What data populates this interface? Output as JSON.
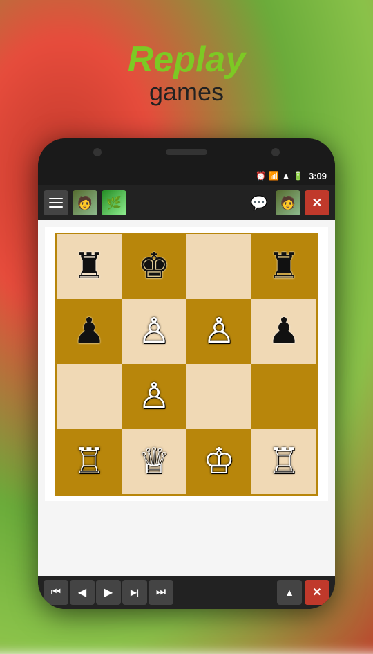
{
  "title": {
    "replay": "Replay",
    "games": "games"
  },
  "status_bar": {
    "time": "3:09",
    "icons": [
      "alarm",
      "wifi",
      "signal",
      "battery"
    ]
  },
  "toolbar": {
    "menu_label": "menu",
    "chat_icon": "💬",
    "avatar_icon": "👤",
    "close_label": "✕"
  },
  "chess_board": {
    "cells": [
      {
        "row": 0,
        "col": 0,
        "color": "light",
        "piece": "♜",
        "piece_name": "black-rook"
      },
      {
        "row": 0,
        "col": 1,
        "color": "dark",
        "piece": "♚",
        "piece_name": "black-king"
      },
      {
        "row": 0,
        "col": 2,
        "color": "light",
        "piece": "",
        "piece_name": null
      },
      {
        "row": 0,
        "col": 3,
        "color": "dark",
        "piece": "♜",
        "piece_name": "black-rook"
      },
      {
        "row": 1,
        "col": 0,
        "color": "dark",
        "piece": "♟",
        "piece_name": "black-pawn"
      },
      {
        "row": 1,
        "col": 1,
        "color": "light",
        "piece": "♙",
        "piece_name": "white-pawn"
      },
      {
        "row": 1,
        "col": 2,
        "color": "dark",
        "piece": "♙",
        "piece_name": "white-pawn"
      },
      {
        "row": 1,
        "col": 3,
        "color": "light",
        "piece": "♟",
        "piece_name": "black-pawn"
      },
      {
        "row": 2,
        "col": 0,
        "color": "light",
        "piece": "",
        "piece_name": null
      },
      {
        "row": 2,
        "col": 1,
        "color": "dark",
        "piece": "♙",
        "piece_name": "white-pawn"
      },
      {
        "row": 2,
        "col": 2,
        "color": "light",
        "piece": "",
        "piece_name": null
      },
      {
        "row": 2,
        "col": 3,
        "color": "dark",
        "piece": "",
        "piece_name": null
      },
      {
        "row": 3,
        "col": 0,
        "color": "dark",
        "piece": "♖",
        "piece_name": "white-rook"
      },
      {
        "row": 3,
        "col": 1,
        "color": "light",
        "piece": "♕",
        "piece_name": "white-queen"
      },
      {
        "row": 3,
        "col": 2,
        "color": "dark",
        "piece": "♔",
        "piece_name": "white-king"
      },
      {
        "row": 3,
        "col": 3,
        "color": "light",
        "piece": "♖",
        "piece_name": "white-rook"
      }
    ]
  },
  "bottom_controls": {
    "first_label": "⏮",
    "prev_label": "◀",
    "play_label": "▶",
    "next_label": "▶|",
    "last_label": "⏭",
    "up_label": "▲",
    "close_label": "✕"
  },
  "colors": {
    "accent_green": "#7dc924",
    "board_light": "#f0d9b5",
    "board_dark": "#b8860b",
    "toolbar_bg": "#222222",
    "close_red": "#c0392b"
  }
}
